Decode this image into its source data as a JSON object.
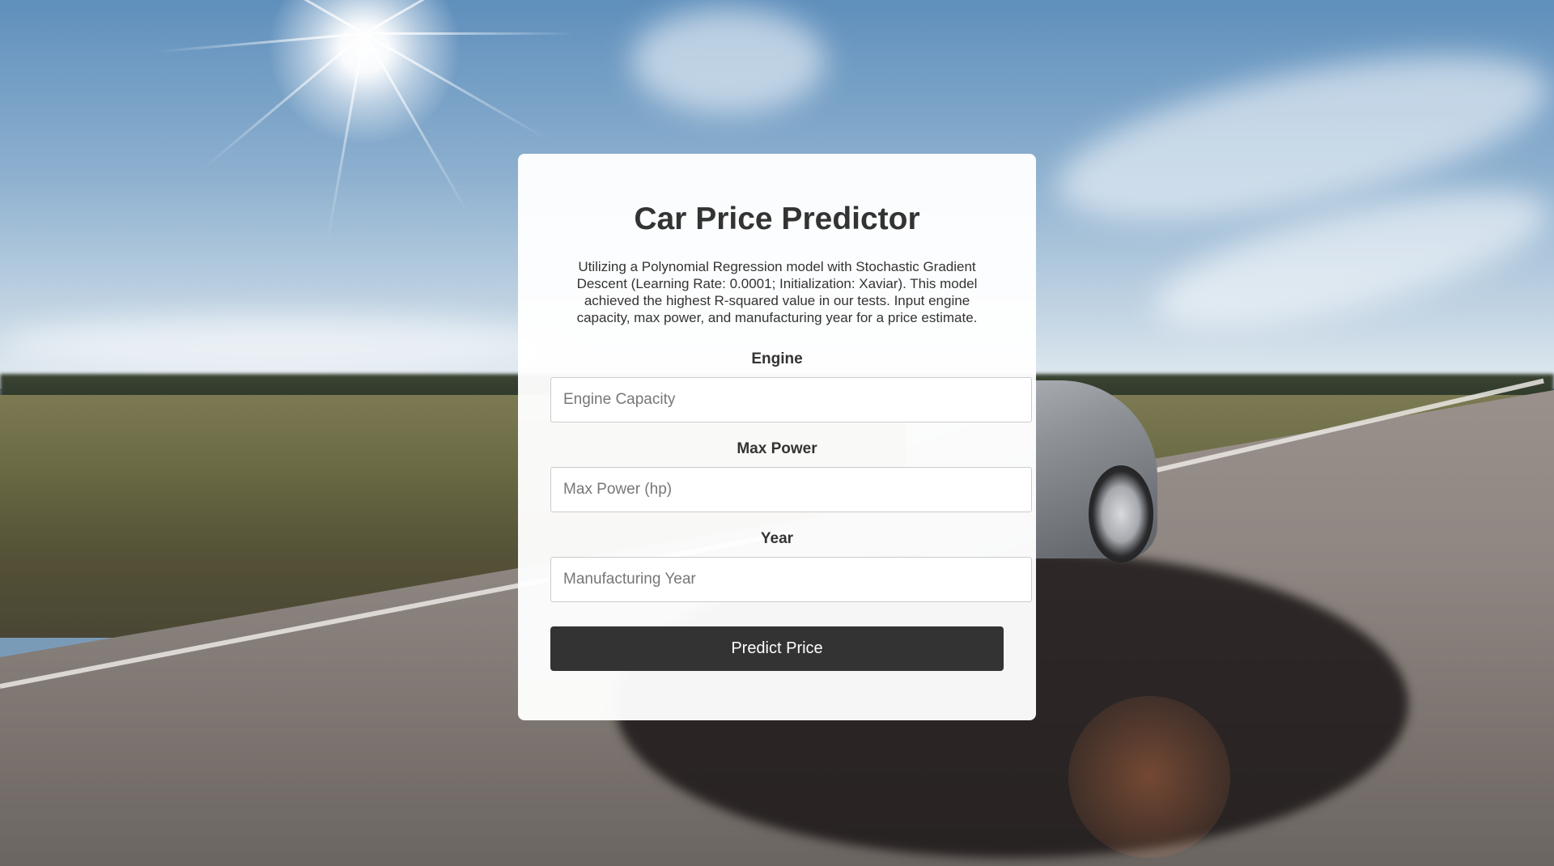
{
  "page": {
    "title": "Car Price Predictor",
    "description": "Utilizing a Polynomial Regression model with Stochastic Gradient Descent (Learning Rate: 0.0001; Initialization: Xaviar). This model achieved the highest R-squared value in our tests. Input engine capacity, max power, and manufacturing year for a price estimate."
  },
  "form": {
    "engine": {
      "label": "Engine",
      "placeholder": "Engine Capacity",
      "value": ""
    },
    "max_power": {
      "label": "Max Power",
      "placeholder": "Max Power (hp)",
      "value": ""
    },
    "year": {
      "label": "Year",
      "placeholder": "Manufacturing Year",
      "value": ""
    },
    "submit_label": "Predict Price"
  },
  "colors": {
    "text": "#333333",
    "button_bg": "#333333",
    "button_text": "#ffffff",
    "card_bg": "#ffffff"
  }
}
